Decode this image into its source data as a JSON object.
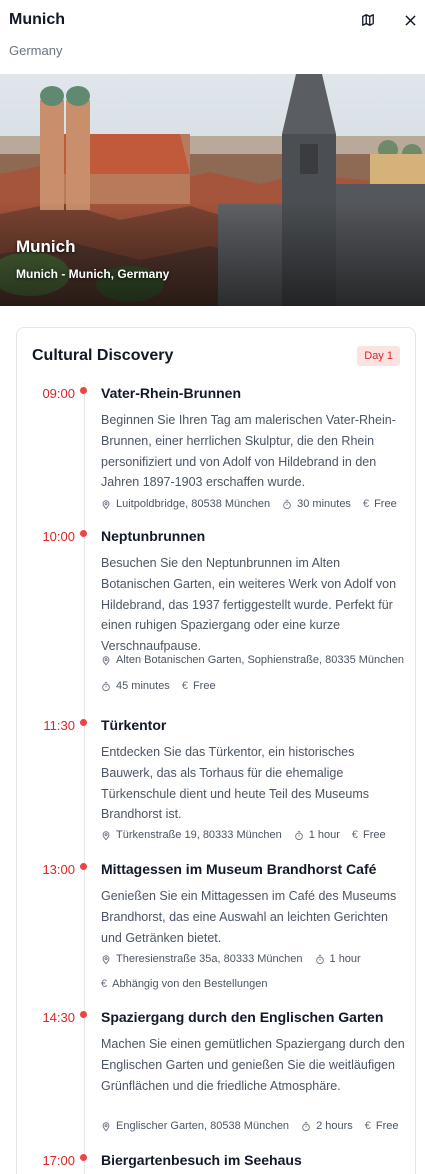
{
  "header": {
    "title": "Munich",
    "subtitle": "Germany"
  },
  "hero": {
    "title": "Munich",
    "subtitle": "Munich - Munich, Germany"
  },
  "card": {
    "title": "Cultural Discovery",
    "badge": "Day 1"
  },
  "items": [
    {
      "time": "09:00",
      "name": "Vater-Rhein-Brunnen",
      "description": "Beginnen Sie Ihren Tag am malerischen Vater-Rhein-Brunnen, einer herrlichen Skulptur, die den Rhein personifiziert und von Adolf von Hildebrand in den Jahren 1897-1903 erschaffen wurde.",
      "location": "Luitpoldbridge, 80538 München",
      "duration": "30 minutes",
      "price": "Free"
    },
    {
      "time": "10:00",
      "name": "Neptunbrunnen",
      "description": "Besuchen Sie den Neptunbrunnen im Alten Botanischen Garten, ein weiteres Werk von Adolf von Hildebrand, das 1937 fertiggestellt wurde. Perfekt für einen ruhigen Spaziergang oder eine kurze Verschnaufpause.",
      "location": "Alten Botanischen Garten, Sophienstraße, 80335 München",
      "duration": "45 minutes",
      "price": "Free"
    },
    {
      "time": "11:30",
      "name": "Türkentor",
      "description": "Entdecken Sie das Türkentor, ein historisches Bauwerk, das als Torhaus für die ehemalige Türkenschule dient und heute Teil des Museums Brandhorst ist.",
      "location": "Türkenstraße 19, 80333 München",
      "duration": "1 hour",
      "price": "Free"
    },
    {
      "time": "13:00",
      "name": "Mittagessen im Museum Brandhorst Café",
      "description": "Genießen Sie ein Mittagessen im Café des Museums Brandhorst, das eine Auswahl an leichten Gerichten und Getränken bietet.",
      "location": "Theresienstraße 35a, 80333 München",
      "duration": "1 hour",
      "price": "Abhängig von den Bestellungen"
    },
    {
      "time": "14:30",
      "name": "Spaziergang durch den Englischen Garten",
      "description": "Machen Sie einen gemütlichen Spaziergang durch den Englischen Garten und genießen Sie die weitläufigen Grünflächen und die friedliche Atmosphäre.",
      "location": "Englischer Garten, 80538 München",
      "duration": "2 hours",
      "price": "Free"
    },
    {
      "time": "17:00",
      "name": "Biergartenbesuch im Seehaus"
    }
  ]
}
